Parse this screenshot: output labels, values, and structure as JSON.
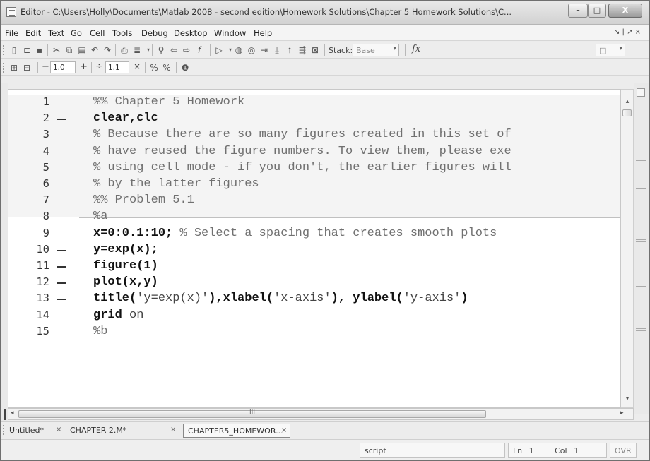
{
  "window": {
    "title": "Editor - C:\\Users\\Holly\\Documents\\Matlab 2008 - second edition\\Homework Solutions\\Chapter 5 Homework Solutions\\C...",
    "minimize": "–",
    "maximize": "□",
    "close": "X"
  },
  "menu": {
    "items": [
      "File",
      "Edit",
      "Text",
      "Go",
      "Cell",
      "Tools",
      "Debug",
      "Desktop",
      "Window",
      "Help"
    ],
    "dock_icons": "↘ | ↗ ×"
  },
  "toolbar1": {
    "stack_label": "Stack:",
    "stack_value": "Base",
    "fx_label": "fx"
  },
  "toolbar2": {
    "minus": "−",
    "value1": "1.0",
    "plus": "+",
    "divide": "÷",
    "value2": "1.1",
    "times": "×"
  },
  "editor": {
    "lines": [
      {
        "num": "1",
        "dash": false,
        "html": "<span class='cm'>%% Chapter 5 Homework</span>"
      },
      {
        "num": "2",
        "dash": true,
        "html": "<span class='kw'>clear,clc</span>"
      },
      {
        "num": "3",
        "dash": false,
        "html": "<span class='cm'>% Because there are so many figures created in this set of </span>"
      },
      {
        "num": "4",
        "dash": false,
        "html": "<span class='cm'>% have reused the figure numbers.  To view them, please exe</span>"
      },
      {
        "num": "5",
        "dash": false,
        "html": "<span class='cm'>% using cell mode - if you don't, the earlier figures will </span>"
      },
      {
        "num": "6",
        "dash": false,
        "html": "<span class='cm'>% by the latter figures</span>"
      },
      {
        "num": "7",
        "dash": false,
        "html": "<span class='cm'>%% Problem 5.1</span>"
      },
      {
        "num": "8",
        "dash": false,
        "html": "<span class='cm'>%a</span>"
      },
      {
        "num": "9",
        "dash": true,
        "html": "<span class='kw'>x=0:0.1:10;</span>  <span class='cm'>% Select a spacing that creates smooth plots</span>"
      },
      {
        "num": "10",
        "dash": true,
        "html": "<span class='kw'>y=exp(x);</span>"
      },
      {
        "num": "11",
        "dash": true,
        "html": "<span class='kw'>figure(1)</span>"
      },
      {
        "num": "12",
        "dash": true,
        "html": "<span class='kw'>plot(x,y)</span>"
      },
      {
        "num": "13",
        "dash": true,
        "html": "<span class='kw'>title(</span><span class='str'>'y=exp(x)'</span><span class='kw'>),xlabel(</span><span class='str'>'x-axis'</span><span class='kw'>), ylabel(</span><span class='str'>'y-axis'</span><span class='kw'>)</span>"
      },
      {
        "num": "14",
        "dash": true,
        "html": "<span class='kw'>grid</span> <span class='str'>on</span>"
      },
      {
        "num": "15",
        "dash": false,
        "html": "<span class='cm'>%b</span>"
      }
    ]
  },
  "hscroll_grip": "III",
  "tabs": [
    {
      "label": "Untitled*",
      "active": false
    },
    {
      "label": "CHAPTER 2.M*",
      "active": false
    },
    {
      "label": "CHAPTER5_HOMEWOR...",
      "active": true
    }
  ],
  "tab_close": "×",
  "status": {
    "mode": "script",
    "line": "Ln",
    "line_value": "1",
    "col": "Col",
    "col_value": "1",
    "ovr": "OVR"
  }
}
